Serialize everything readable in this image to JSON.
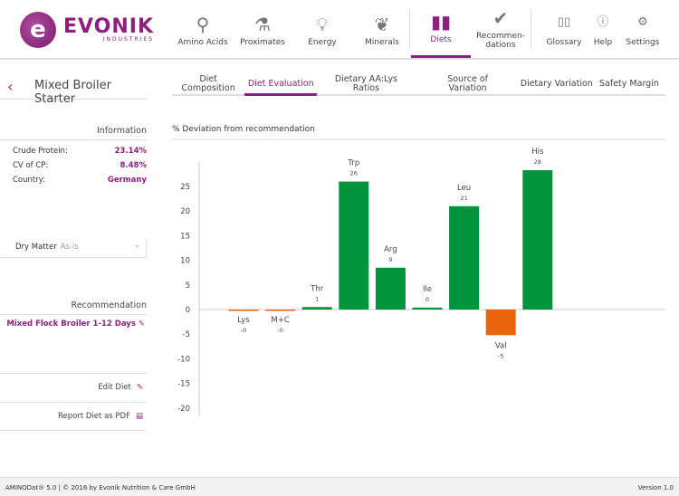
{
  "brand": {
    "name": "EVONIK",
    "sub": "INDUSTRIES"
  },
  "nav": [
    {
      "label": "Amino Acids",
      "icon": "molecule-icon"
    },
    {
      "label": "Proximates",
      "icon": "flask-icon"
    },
    {
      "label": "Energy",
      "icon": "lightbulb-icon"
    },
    {
      "label": "Minerals",
      "icon": "leaf-icon"
    },
    {
      "label": "Diets",
      "icon": "diets-icon",
      "active": true
    },
    {
      "label": "Recommen-\ndations",
      "icon": "check-badge-icon"
    },
    {
      "label": "Glossary",
      "icon": "book-icon"
    },
    {
      "label": "Help",
      "icon": "help-icon"
    },
    {
      "label": "Settings",
      "icon": "gear-icon"
    }
  ],
  "diet_title": "Mixed Broiler Starter",
  "tabs": [
    "Diet Composition",
    "Diet Evaluation",
    "Dietary AA:Lys Ratios",
    "Source of Variation",
    "Dietary Variation",
    "Safety Margin"
  ],
  "active_tab": "Diet Evaluation",
  "info": {
    "heading": "Information",
    "rows": [
      {
        "k": "Crude Protein:",
        "v": "23.14%"
      },
      {
        "k": "CV of CP:",
        "v": "8.48%"
      },
      {
        "k": "Country:",
        "v": "Germany"
      }
    ]
  },
  "dry_matter": {
    "label": "Dry Matter",
    "value": "As-is"
  },
  "recommendation": {
    "heading": "Recommendation",
    "value": "Mixed Flock Broiler 1-12 Days"
  },
  "actions": {
    "edit": "Edit Diet",
    "report": "Report Diet as PDF"
  },
  "colors": {
    "brand": "#8e1f7e",
    "positive": "#00953d",
    "negative": "#e8650c"
  },
  "chart_data": {
    "type": "bar",
    "title": "% Deviation from recommendation",
    "categories": [
      "Lys",
      "M+C",
      "Thr",
      "Trp",
      "Arg",
      "Ile",
      "Leu",
      "Val",
      "His"
    ],
    "values": [
      -0.2,
      -0.05,
      0.5,
      26,
      8.5,
      0.4,
      21,
      -5.2,
      28.3
    ],
    "value_labels": [
      "-0",
      "-0",
      "1",
      "26",
      "9",
      "0",
      "21",
      "-5",
      "28"
    ],
    "yticks": [
      25,
      20,
      15,
      10,
      5,
      0,
      -5,
      -10,
      -15,
      -20
    ],
    "ylim": [
      -22,
      30
    ],
    "grid": false
  },
  "footer": {
    "left": "AMINODat® 5.0 | © 2016 by Evonik Nutrition & Care GmbH",
    "right": "Version 1.0"
  }
}
